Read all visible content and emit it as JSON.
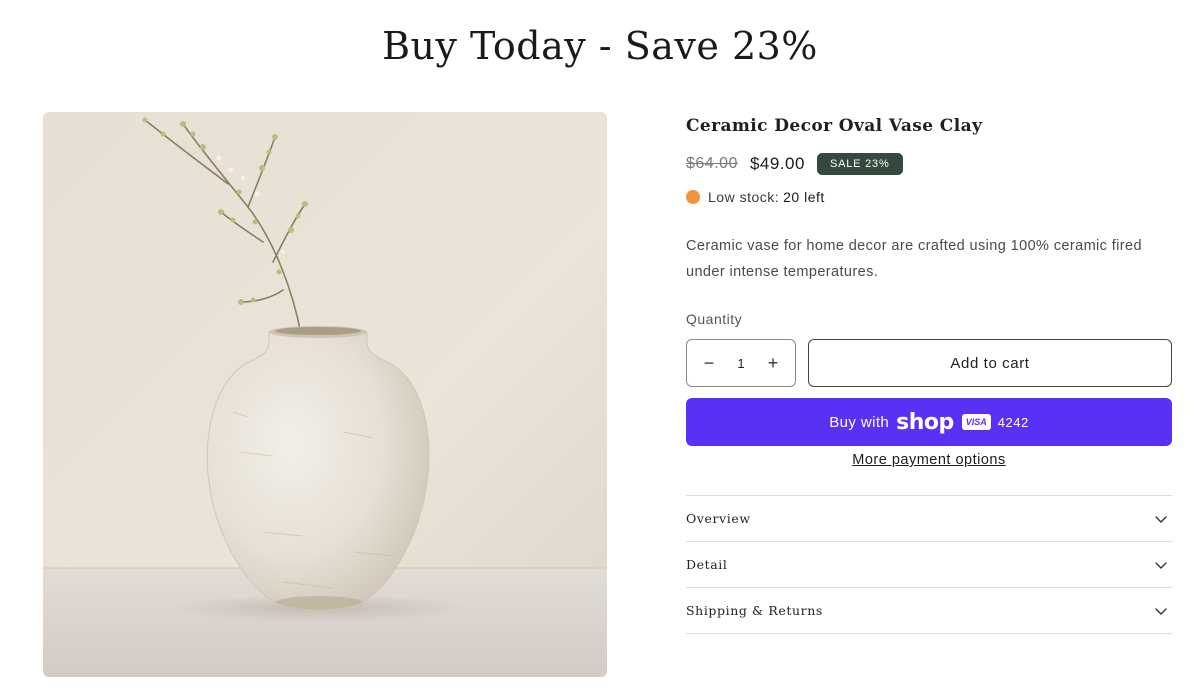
{
  "header": {
    "title": "Buy Today - Save 23%"
  },
  "product": {
    "image_alt": "Ceramic Decor Oval Vase Clay",
    "title": "Ceramic Decor Oval Vase Clay",
    "price_old": "$64.00",
    "price_new": "$49.00",
    "sale_badge": "SALE 23%",
    "stock_label": "Low stock:",
    "stock_count": "20 left",
    "description": "Ceramic vase for home decor are crafted using 100% ceramic fired under intense temperatures."
  },
  "quantity": {
    "label": "Quantity",
    "minus": "−",
    "value": "1",
    "plus": "+"
  },
  "actions": {
    "add_to_cart": "Add to cart",
    "buy_with": "Buy with",
    "shop_logo": "shop",
    "card_brand": "VISA",
    "card_digits": "4242",
    "more_payment": "More payment options"
  },
  "accordion": [
    {
      "label": "Overview"
    },
    {
      "label": "Detail"
    },
    {
      "label": "Shipping & Returns"
    }
  ],
  "colors": {
    "accent": "#5a31f4",
    "sale_badge": "#334a3f",
    "stock_dot": "#f0933a"
  },
  "icons": {
    "chevron": "chevron-down-icon",
    "stock": "low-stock-dot-icon"
  }
}
